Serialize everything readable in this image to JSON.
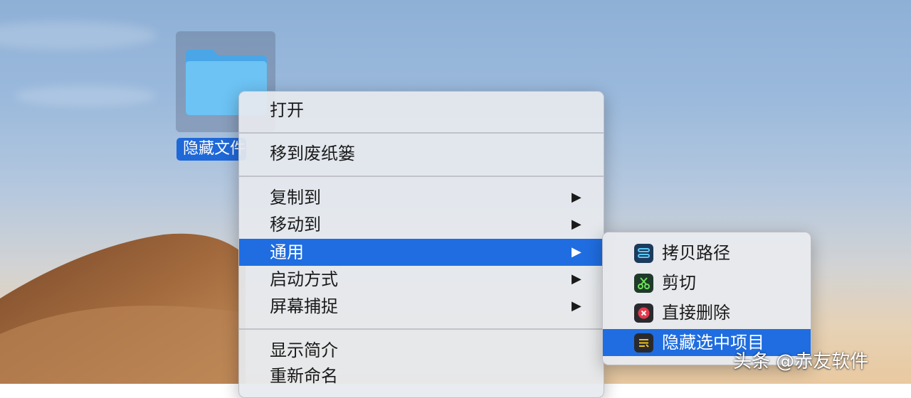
{
  "desktop": {
    "folder": {
      "name": "隐藏文件",
      "icon": "folder-icon"
    }
  },
  "context_menu": {
    "items": [
      {
        "label": "打开"
      },
      {
        "label": "移到废纸篓"
      },
      {
        "label": "复制到",
        "arrow": "▶"
      },
      {
        "label": "移动到",
        "arrow": "▶"
      },
      {
        "label": "通用",
        "arrow": "▶"
      },
      {
        "label": "启动方式",
        "arrow": "▶"
      },
      {
        "label": "屏幕捕捉",
        "arrow": "▶"
      },
      {
        "label": "显示简介"
      },
      {
        "label": "重新命名"
      }
    ]
  },
  "submenu": {
    "items": [
      {
        "label": "拷贝路径",
        "icon": "copy-path-icon"
      },
      {
        "label": "剪切",
        "icon": "scissors-icon"
      },
      {
        "label": "直接删除",
        "icon": "delete-icon"
      },
      {
        "label": "隐藏选中项目",
        "icon": "hide-icon"
      }
    ]
  },
  "watermark": "头条 @赤友软件",
  "colors": {
    "selection": "#1f6de0",
    "folder": "#5ab4ef"
  }
}
